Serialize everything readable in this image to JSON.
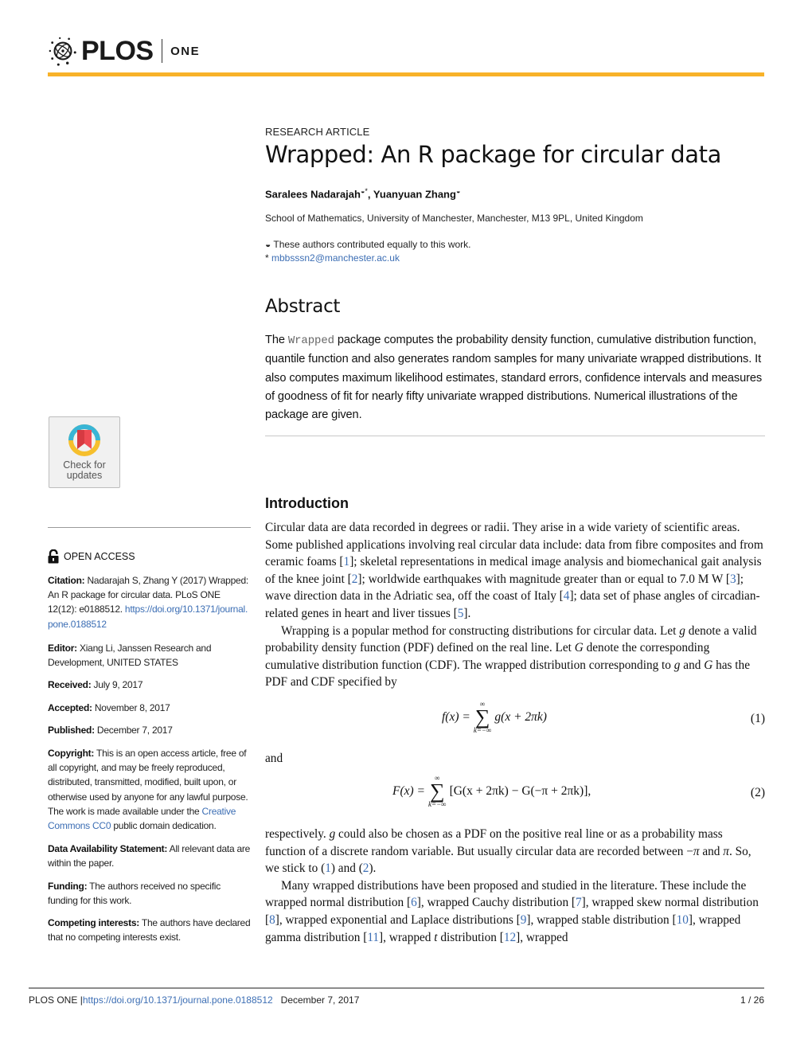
{
  "header": {
    "journal_brand": "PLOS",
    "journal_name": "ONE",
    "accent_color": "#f8b229"
  },
  "article": {
    "type": "RESEARCH ARTICLE",
    "title": "Wrapped: An R package for circular data",
    "authors": [
      {
        "name": "Saralees Nadarajah",
        "marks": "◒*"
      },
      {
        "name": "Yuanyuan Zhang",
        "marks": "◒"
      }
    ],
    "author_separator": ", ",
    "affiliation": "School of Mathematics, University of Manchester, Manchester, M13 9PL, United Kingdom",
    "contribution_note": "These authors contributed equally to this work.",
    "contribution_symbol": "◒",
    "corresponding_symbol": "* ",
    "email": "mbbsssn2@manchester.ac.uk"
  },
  "abstract": {
    "heading": "Abstract",
    "lead": "The ",
    "package_name": "Wrapped",
    "text": " package computes the probability density function, cumulative distribution function, quantile function and also generates random samples for many univariate wrapped distributions. It also computes maximum likelihood estimates, standard errors, confidence intervals and measures of goodness of fit for nearly fifty univariate wrapped distributions. Numerical illustrations of the package are given."
  },
  "sidebar": {
    "check_updates": {
      "line1": "Check for",
      "line2": "updates"
    },
    "open_access": "OPEN ACCESS",
    "citation": {
      "label": "Citation:",
      "text": " Nadarajah S, Zhang Y (2017) Wrapped: An R package for circular data. PLoS ONE 12(12): e0188512. ",
      "link": "https://doi.org/10.1371/journal.pone.0188512"
    },
    "editor": {
      "label": "Editor:",
      "text": " Xiang Li, Janssen Research and Development, UNITED STATES"
    },
    "received": {
      "label": "Received:",
      "text": " July 9, 2017"
    },
    "accepted": {
      "label": "Accepted:",
      "text": " November 8, 2017"
    },
    "published": {
      "label": "Published:",
      "text": " December 7, 2017"
    },
    "copyright": {
      "label": "Copyright:",
      "text": " This is an open access article, free of all copyright, and may be freely reproduced, distributed, transmitted, modified, built upon, or otherwise used by anyone for any lawful purpose. The work is made available under the ",
      "link": "Creative Commons CC0",
      "tail": " public domain dedication."
    },
    "data_availability": {
      "label": "Data Availability Statement:",
      "text": " All relevant data are within the paper."
    },
    "funding": {
      "label": "Funding:",
      "text": " The authors received no specific funding for this work."
    },
    "competing": {
      "label": "Competing interests:",
      "text": " The authors have declared that no competing interests exist."
    }
  },
  "introduction": {
    "heading": "Introduction",
    "p1": {
      "s1": "Circular data are data recorded in degrees or radii. They arise in a wide variety of scientific areas. Some published applications involving real circular data include: data from fibre composites and from ceramic foams [",
      "r1": "1",
      "s2": "]; skeletal representations in medical image analysis and biomechanical gait analysis of the knee joint [",
      "r2": "2",
      "s3": "]; worldwide earthquakes with magnitude greater than or equal to 7.0 M W [",
      "r3": "3",
      "s4": "]; wave direction data in the Adriatic sea, off the coast of Italy [",
      "r4": "4",
      "s5": "]; data set of phase angles of circadian-related genes in heart and liver tissues [",
      "r5": "5",
      "s6": "]."
    },
    "p2": {
      "s1": "Wrapping is a popular method for constructing distributions for circular data. Let ",
      "g1": "g",
      "s2": " denote a valid probability density function (PDF) defined on the real line. Let ",
      "G1": "G",
      "s3": " denote the corresponding cumulative distribution function (CDF). The wrapped distribution corresponding to ",
      "g2": "g",
      "s4": " and ",
      "G2": "G",
      "s5": " has the PDF and CDF specified by"
    },
    "eq1": {
      "lhs": "f(x) =",
      "sum_top": "∞",
      "sum_bottom": "k=−∞",
      "rhs": "g(x + 2πk)",
      "number": "(1)"
    },
    "and": "and",
    "eq2": {
      "lhs": "F(x) =",
      "sum_top": "∞",
      "sum_bottom": "k=−∞",
      "rhs": "[G(x + 2πk) − G(−π + 2πk)],",
      "number": "(2)"
    },
    "p3": {
      "s1": "respectively. ",
      "g": "g",
      "s2": " could also be chosen as a PDF on the positive real line or as a probability mass function of a discrete random variable. But usually circular data are recorded between −",
      "pi1": "π",
      "s3": " and ",
      "pi2": "π",
      "s4": ". So, we stick to (",
      "r1": "1",
      "s5": ") and (",
      "r2": "2",
      "s6": ")."
    },
    "p4": {
      "s1": "Many wrapped distributions have been proposed and studied in the literature. These include the wrapped normal distribution [",
      "r6": "6",
      "s2": "], wrapped Cauchy distribution [",
      "r7": "7",
      "s3": "], wrapped skew normal distribution [",
      "r8": "8",
      "s4": "], wrapped exponential and Laplace distributions [",
      "r9": "9",
      "s5": "], wrapped stable distribution [",
      "r10": "10",
      "s6": "], wrapped gamma distribution [",
      "r11": "11",
      "s7": "], wrapped ",
      "t": "t",
      "s8": " distribution [",
      "r12": "12",
      "s9": "], wrapped"
    }
  },
  "footer": {
    "journal": "PLOS ONE | ",
    "doi": "https://doi.org/10.1371/journal.pone.0188512",
    "date": "December 7, 2017",
    "page": "1 / 26"
  }
}
